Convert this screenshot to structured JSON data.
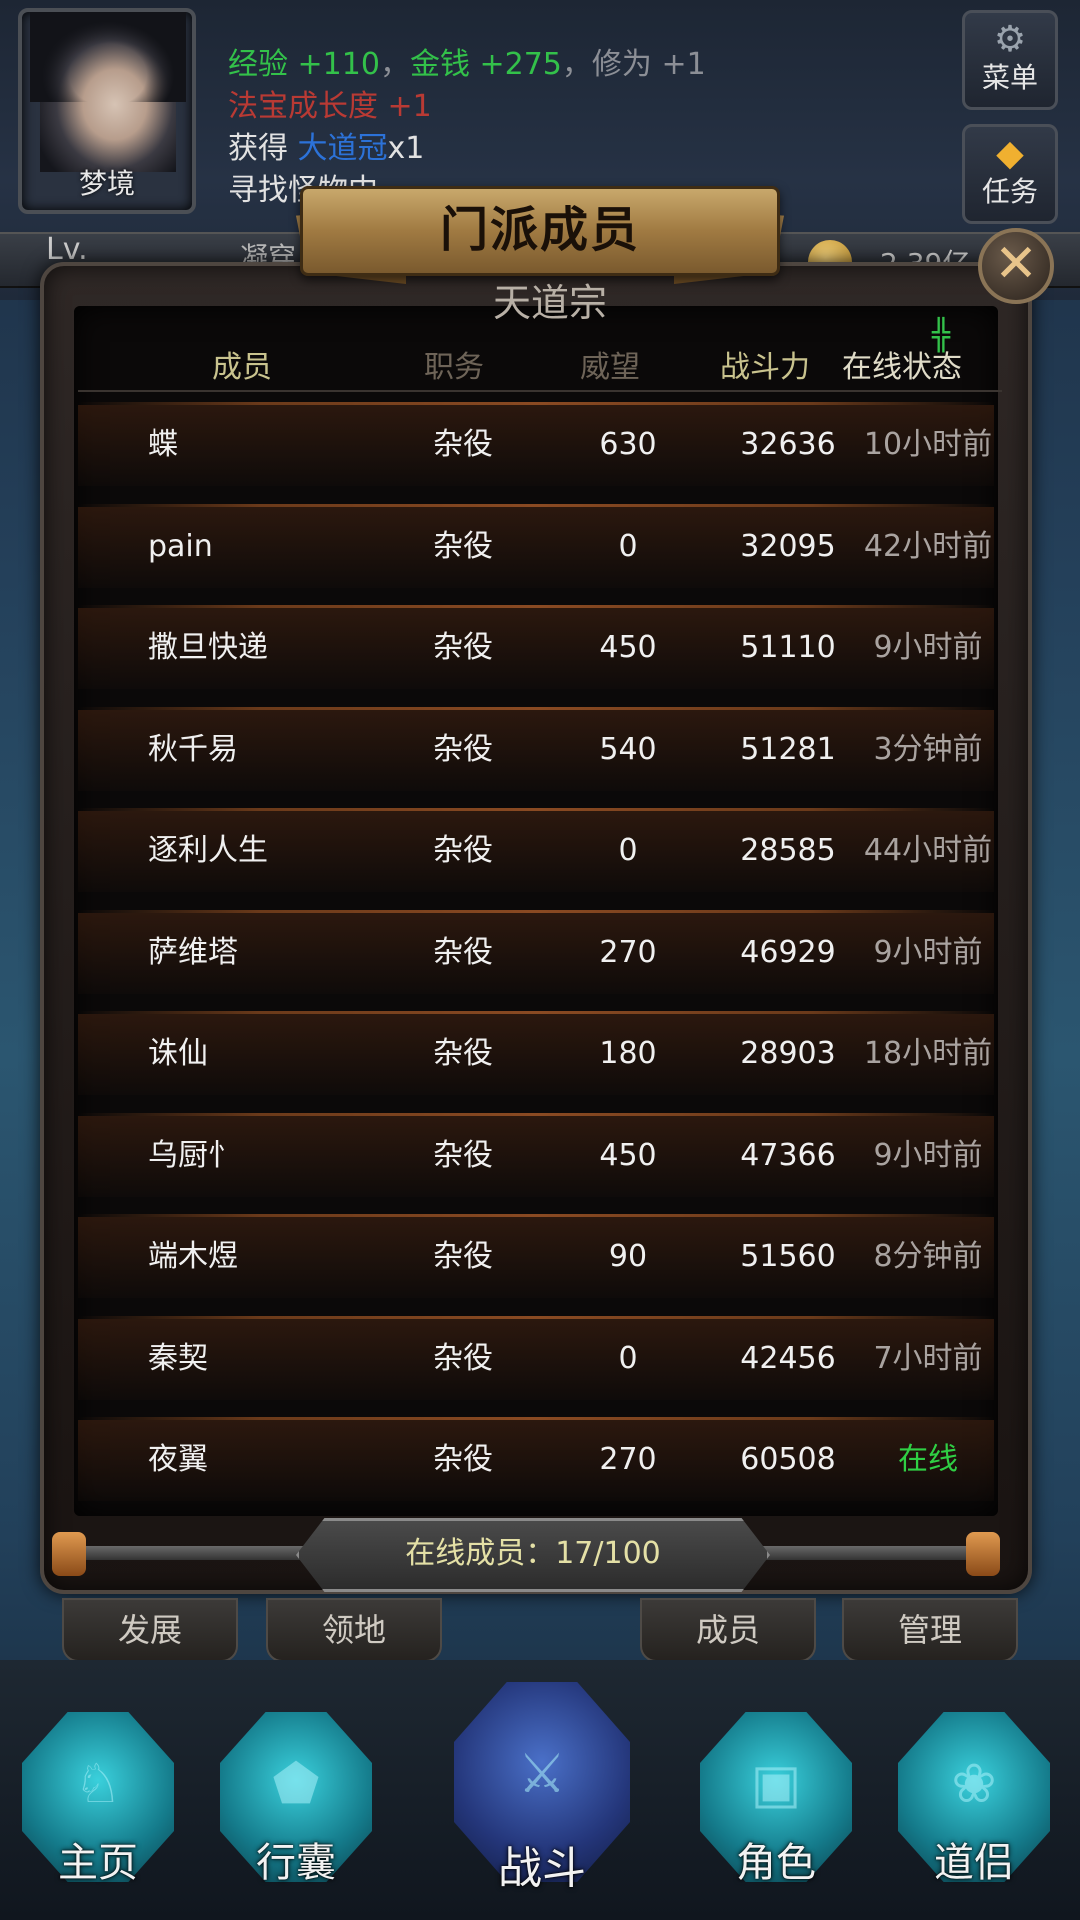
{
  "player": {
    "name": "梦境",
    "level_prefix": "Lv.",
    "realm_partial": "凝穿",
    "coins": "2.39亿"
  },
  "log": {
    "line1": [
      {
        "text": "经验 ",
        "color": "green"
      },
      {
        "text": "+110",
        "color": "green"
      },
      {
        "text": "，",
        "color": "grey"
      },
      {
        "text": "金钱 ",
        "color": "green"
      },
      {
        "text": "+275",
        "color": "green"
      },
      {
        "text": "，修为 +1",
        "color": "grey"
      }
    ],
    "line2": "法宝成长度 +1",
    "line3_prefix": "获得 ",
    "line3_item": "大道冠",
    "line3_suffix": "x1",
    "line4": "寻找怪物中.."
  },
  "side_buttons": {
    "menu": "菜单",
    "task": "任务"
  },
  "dialog": {
    "title": "门派成员",
    "sect_name": "天道宗",
    "columns": [
      "成员",
      "职务",
      "威望",
      "战斗力",
      "在线状态"
    ],
    "sort_mark": "╬",
    "members": [
      {
        "name": "蝶",
        "role": "杂役",
        "reputation": "630",
        "power": "32636",
        "status": "10小时前"
      },
      {
        "name": "pain",
        "role": "杂役",
        "reputation": "0",
        "power": "32095",
        "status": "42小时前"
      },
      {
        "name": "撒旦快递",
        "role": "杂役",
        "reputation": "450",
        "power": "51110",
        "status": "9小时前"
      },
      {
        "name": "秋千易",
        "role": "杂役",
        "reputation": "540",
        "power": "51281",
        "status": "3分钟前"
      },
      {
        "name": "逐利人生",
        "role": "杂役",
        "reputation": "0",
        "power": "28585",
        "status": "44小时前"
      },
      {
        "name": "萨维塔",
        "role": "杂役",
        "reputation": "270",
        "power": "46929",
        "status": "9小时前"
      },
      {
        "name": "诛仙",
        "role": "杂役",
        "reputation": "180",
        "power": "28903",
        "status": "18小时前"
      },
      {
        "name": "乌厨忄",
        "role": "杂役",
        "reputation": "450",
        "power": "47366",
        "status": "9小时前"
      },
      {
        "name": "端木煜",
        "role": "杂役",
        "reputation": "90",
        "power": "51560",
        "status": "8分钟前"
      },
      {
        "name": "秦契",
        "role": "杂役",
        "reputation": "0",
        "power": "42456",
        "status": "7小时前"
      },
      {
        "name": "夜翼",
        "role": "杂役",
        "reputation": "270",
        "power": "60508",
        "status": "在线",
        "online": true
      }
    ],
    "online_banner": "在线成员：17/100"
  },
  "sub_tabs": [
    "发展",
    "领地",
    "成员",
    "管理"
  ],
  "bottom_nav": [
    "主页",
    "行囊",
    "战斗",
    "角色",
    "道侣"
  ],
  "colors": {
    "online_green": "#2fcf44",
    "header_gold": "#c9c38e"
  }
}
